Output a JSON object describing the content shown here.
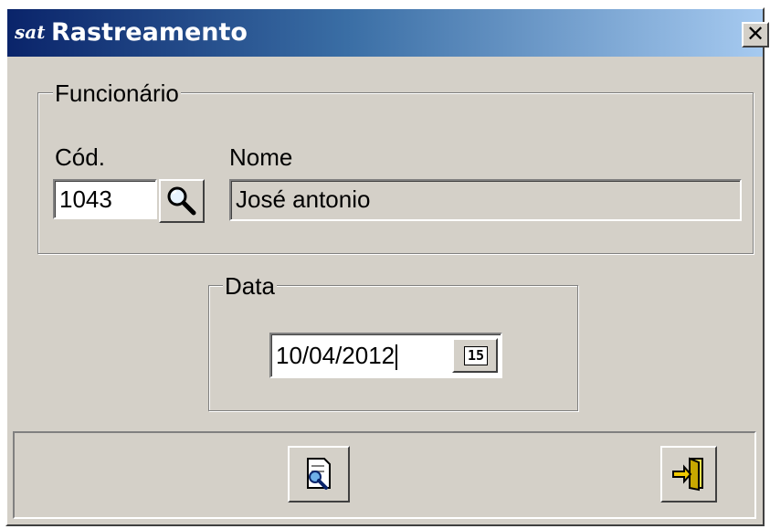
{
  "window": {
    "title": "Rastreamento",
    "logo_text": "sat",
    "close_label": "✕"
  },
  "employee_group": {
    "legend": "Funcionário",
    "code_label": "Cód.",
    "code_value": "1043",
    "name_label": "Nome",
    "name_value": "José antonio"
  },
  "date_group": {
    "legend": "Data",
    "date_value": "10/04/2012",
    "calendar_day": "15"
  },
  "icons": {
    "lookup": "magnifier-icon",
    "calendar": "calendar-icon",
    "search_report": "document-search-icon",
    "exit": "exit-door-icon"
  }
}
